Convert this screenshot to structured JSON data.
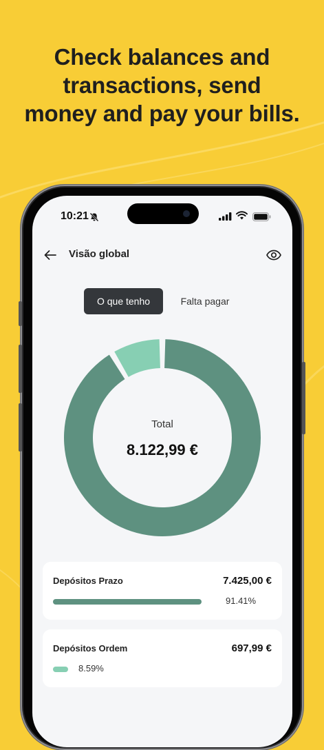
{
  "headline": {
    "line1": "Check balances and",
    "line2": "transactions, send",
    "line3": "money and pay your bills."
  },
  "status_bar": {
    "time": "10:21",
    "icons": [
      "bell-slash-icon",
      "cellular-signal-icon",
      "wifi-icon",
      "battery-icon"
    ]
  },
  "header": {
    "title": "Visão global",
    "back_icon": "arrow-left-icon",
    "visibility_icon": "eye-icon"
  },
  "segmented_control": {
    "options": [
      {
        "label": "O que tenho",
        "selected": true
      },
      {
        "label": "Falta pagar",
        "selected": false
      }
    ]
  },
  "chart_data": {
    "type": "pie",
    "style": "donut",
    "center_label": "Total",
    "center_value": "8.122,99 €",
    "slices": [
      {
        "label": "Depósitos Prazo",
        "value": 91.41,
        "color": "#5E9180"
      },
      {
        "label": "Depósitos Ordem",
        "value": 8.59,
        "color": "#87CFB3"
      }
    ]
  },
  "accounts": [
    {
      "name": "Depósitos Prazo",
      "amount": "7.425,00 €",
      "percent_label": "91.41%",
      "share": 0.9141,
      "color": "#5E9180"
    },
    {
      "name": "Depósitos Ordem",
      "amount": "697,99 €",
      "percent_label": "8.59%",
      "share": 0.0859,
      "color": "#87CFB3"
    }
  ],
  "colors": {
    "background": "#F8CD36",
    "screen": "#F5F6F8",
    "segment_active": "#34373B"
  }
}
